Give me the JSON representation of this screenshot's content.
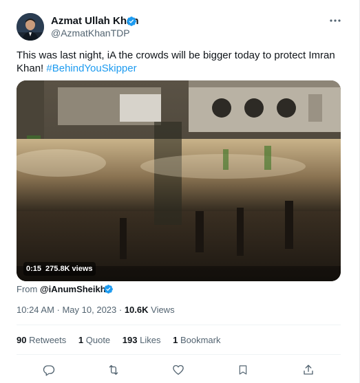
{
  "author": {
    "name": "Azmat Ullah Khan",
    "handle": "@AzmatKhanTDP"
  },
  "tweet": {
    "text": "This was last night, iA the crowds will be bigger today to protect Imran Khan! ",
    "hashtag": "#BehindYouSkipper"
  },
  "video": {
    "duration": "0:15",
    "views": "275.8K views"
  },
  "source": {
    "prefix": "From ",
    "handle": "@iAnumSheikh"
  },
  "meta": {
    "timestamp": "10:24 AM · May 10, 2023 · ",
    "views_count": "10.6K",
    "views_label": " Views"
  },
  "stats": {
    "retweets_count": "90",
    "retweets_label": " Retweets",
    "quotes_count": "1",
    "quotes_label": " Quote",
    "likes_count": "193",
    "likes_label": " Likes",
    "bookmarks_count": "1",
    "bookmarks_label": " Bookmark"
  },
  "icons": {
    "verified": "verified-badge-icon",
    "more": "more-dots-icon",
    "reply": "reply-icon",
    "retweet": "retweet-icon",
    "like": "heart-icon",
    "bookmark": "bookmark-icon",
    "share": "share-icon"
  },
  "colors": {
    "accent": "#1d9bf0",
    "text_primary": "#0f1419",
    "text_secondary": "#536471"
  }
}
